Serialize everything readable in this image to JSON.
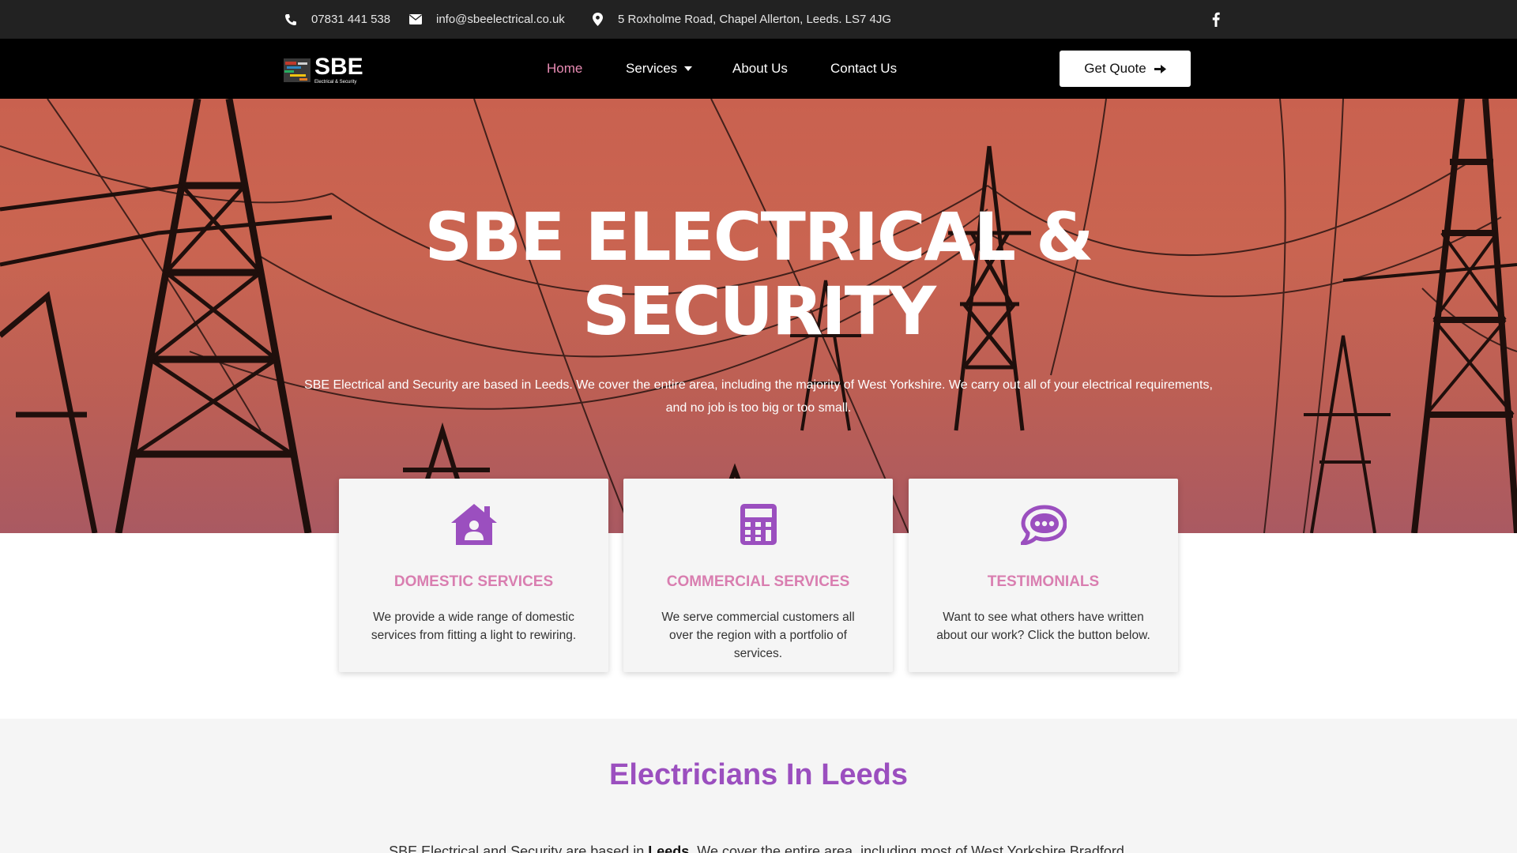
{
  "topbar": {
    "phone": "07831 441 538",
    "email": "info@sbeelectrical.co.uk",
    "address": "5 Roxholme Road, Chapel Allerton, Leeds. LS7 4JG",
    "icons": [
      "phone-icon",
      "envelope-icon",
      "map-pin-icon",
      "facebook-icon"
    ]
  },
  "logo": {
    "main": "SBE",
    "sub": "Electrical & Security"
  },
  "nav": {
    "home": "Home",
    "services": "Services",
    "about": "About Us",
    "contact": "Contact Us",
    "quote": "Get Quote"
  },
  "hero": {
    "title_line1": "SBE ELECTRICAL &",
    "title_line2": "SECURITY",
    "description": "SBE Electrical and Security are based in Leeds. We cover the entire area, including the majority of West Yorkshire. We carry out all of your electrical requirements, and no job is too big or too small."
  },
  "cards": [
    {
      "icon": "house-user-icon",
      "title": "DOMESTIC SERVICES",
      "text": "We provide a wide range of domestic services from fitting a light to rewiring."
    },
    {
      "icon": "calculator-icon",
      "title": "COMMERCIAL SERVICES",
      "text": "We serve commercial customers all over the region with a portfolio of services."
    },
    {
      "icon": "speech-bubble-icon",
      "title": "TESTIMONIALS",
      "text": "Want to see what others have written about our work? Click the button below."
    }
  ],
  "section": {
    "title": "Electricians In Leeds",
    "text_prefix": "SBE Electrical and Security are based in ",
    "text_bold": "Leeds",
    "text_suffix": ". We cover the entire area, including most of West Yorkshire Bradford,"
  },
  "colors": {
    "accent_pink": "#d97eb0",
    "accent_purple": "#9b4fbf",
    "topbar_bg": "#222222",
    "nav_bg": "#000000",
    "hero_bg": "#c9614f"
  }
}
